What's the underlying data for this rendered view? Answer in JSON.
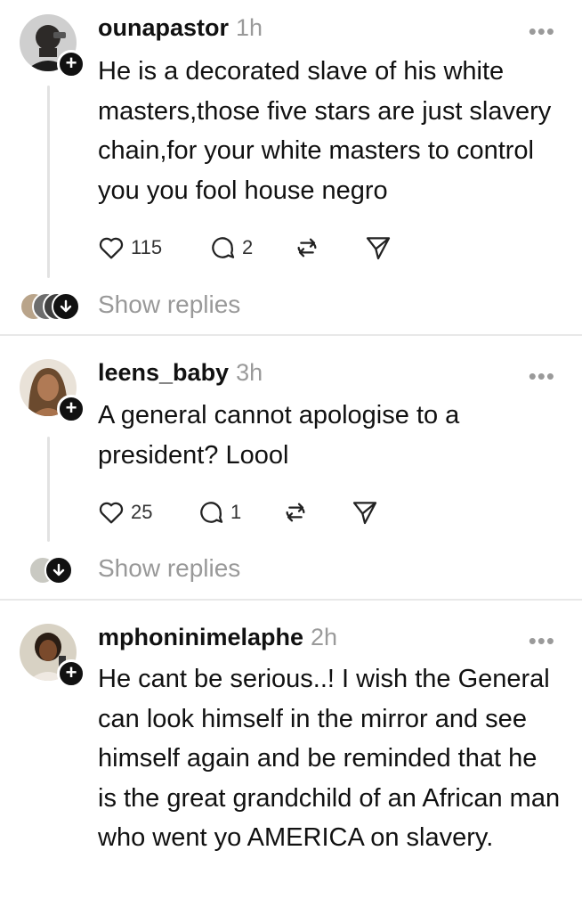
{
  "posts": [
    {
      "username": "ounapastor",
      "time": "1h",
      "text": "He is a decorated slave of his white masters,those five stars are just slavery chain,for your white masters to control you you fool house negro",
      "likes": "115",
      "replies": "2",
      "show_replies": "Show replies"
    },
    {
      "username": "leens_baby",
      "time": "3h",
      "text": "A general cannot apologise to a president? Loool",
      "likes": "25",
      "replies": "1",
      "show_replies": "Show replies"
    },
    {
      "username": "mphoninimelaphe",
      "time": "2h",
      "text": "He cant be serious..! I wish the General can look himself in the mirror and see himself again and be reminded that he is the great grandchild of an African man who went yo AMERICA on slavery."
    }
  ],
  "icons": {
    "follow": "plus-icon",
    "more": "more-icon",
    "like": "heart-icon",
    "reply": "comment-icon",
    "repost": "repost-icon",
    "share": "send-icon",
    "expand": "arrow-down-icon"
  },
  "colors": {
    "text": "#111111",
    "muted": "#9a9a9a",
    "divider": "#e8e8e8"
  }
}
